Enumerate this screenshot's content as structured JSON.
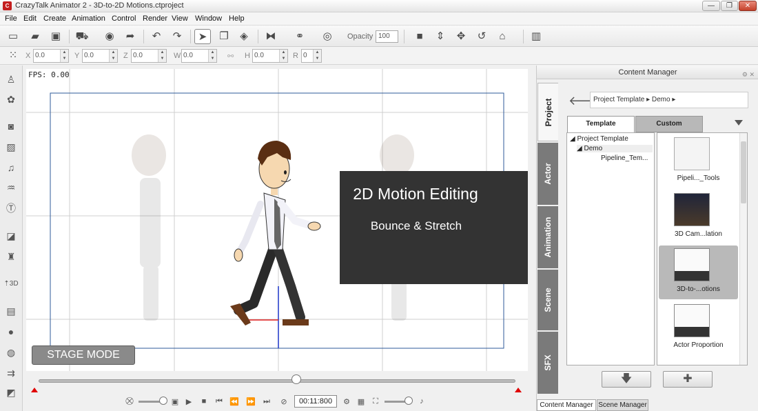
{
  "window": {
    "title": "CrazyTalk Animator 2  -  3D-to-2D Motions.ctproject",
    "minimize": "—",
    "maximize": "❐",
    "close": "✕"
  },
  "menu": [
    "File",
    "Edit",
    "Create",
    "Animation",
    "Control",
    "Render",
    "View",
    "Window",
    "Help"
  ],
  "toolbar": {
    "opacity_label": "Opacity",
    "opacity_value": "100"
  },
  "transform": {
    "fields": [
      {
        "label": "X",
        "value": "0.0"
      },
      {
        "label": "Y",
        "value": "0.0"
      },
      {
        "label": "Z",
        "value": "0.0"
      },
      {
        "label": "W",
        "value": "0.0"
      },
      {
        "label": "H",
        "value": "0.0"
      },
      {
        "label": "R",
        "value": "0"
      }
    ]
  },
  "stage": {
    "fps": "FPS: 0.00",
    "title_main": "2D Motion Editing",
    "title_sub": "Bounce & Stretch",
    "stage_mode": "STAGE MODE"
  },
  "timeline": {
    "time": "00:11:800",
    "progress": 0.54
  },
  "content_manager": {
    "header": "Content Manager",
    "vertical_tabs": [
      "Project",
      "Actor",
      "Animation",
      "Scene",
      "SFX"
    ],
    "breadcrumb": "Project Template ▸  Demo ▸",
    "tabs": [
      "Template",
      "Custom"
    ],
    "tree": [
      "Project Template",
      "Demo",
      "Pipeline_Tem..."
    ],
    "items": [
      {
        "label": "Pipeli..._Tools",
        "selected": false
      },
      {
        "label": "3D Cam...lation",
        "selected": false
      },
      {
        "label": "3D-to-...otions",
        "selected": true
      },
      {
        "label": "Actor Proportion",
        "selected": false
      }
    ],
    "bottom_tabs": [
      "Content Manager",
      "Scene Manager"
    ]
  },
  "colors": {
    "title_card": "#333333",
    "stage_frame": "#2c5a9a",
    "selected_item": "#b9b9b9"
  }
}
